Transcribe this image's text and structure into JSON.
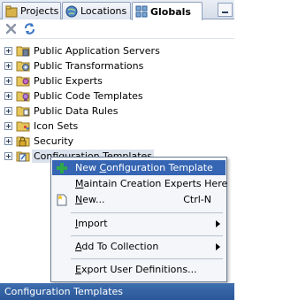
{
  "tabs": [
    {
      "label": "Projects",
      "icon": "projects-icon"
    },
    {
      "label": "Locations",
      "icon": "locations-icon"
    },
    {
      "label": "Globals",
      "icon": "globals-icon",
      "active": true
    }
  ],
  "tree": {
    "items": [
      {
        "label": "Public Application Servers",
        "icon": "folder-server-icon"
      },
      {
        "label": "Public Transformations",
        "icon": "folder-transform-icon"
      },
      {
        "label": "Public Experts",
        "icon": "folder-experts-icon"
      },
      {
        "label": "Public Code Templates",
        "icon": "folder-code-icon"
      },
      {
        "label": "Public Data Rules",
        "icon": "folder-rules-icon"
      },
      {
        "label": "Icon Sets",
        "icon": "folder-iconsets-icon"
      },
      {
        "label": "Security",
        "icon": "security-icon"
      },
      {
        "label": "Configuration Templates",
        "icon": "config-templates-icon",
        "selected": true
      }
    ]
  },
  "context_menu": {
    "items": [
      {
        "label_pre": "New ",
        "label_u": "C",
        "label_post": "onfiguration Template",
        "highlighted": true,
        "icon": "plus-icon"
      },
      {
        "label_pre": "",
        "label_u": "M",
        "label_post": "aintain Creation Experts Here"
      },
      {
        "label_pre": "",
        "label_u": "N",
        "label_post": "ew...",
        "shortcut": "Ctrl-N",
        "icon": "new-icon"
      },
      {
        "label_pre": "",
        "label_u": "I",
        "label_post": "mport",
        "submenu": true
      },
      {
        "label_pre": "",
        "label_u": "A",
        "label_post": "dd To Collection",
        "submenu": true
      },
      {
        "label_pre": "",
        "label_u": "E",
        "label_post": "xport User Definitions..."
      }
    ]
  },
  "status": {
    "text": "Configuration Templates"
  },
  "colors": {
    "status_bg": "#2b5798",
    "menu_highlight": "#3665b3",
    "selection": "#dbe2ec"
  }
}
